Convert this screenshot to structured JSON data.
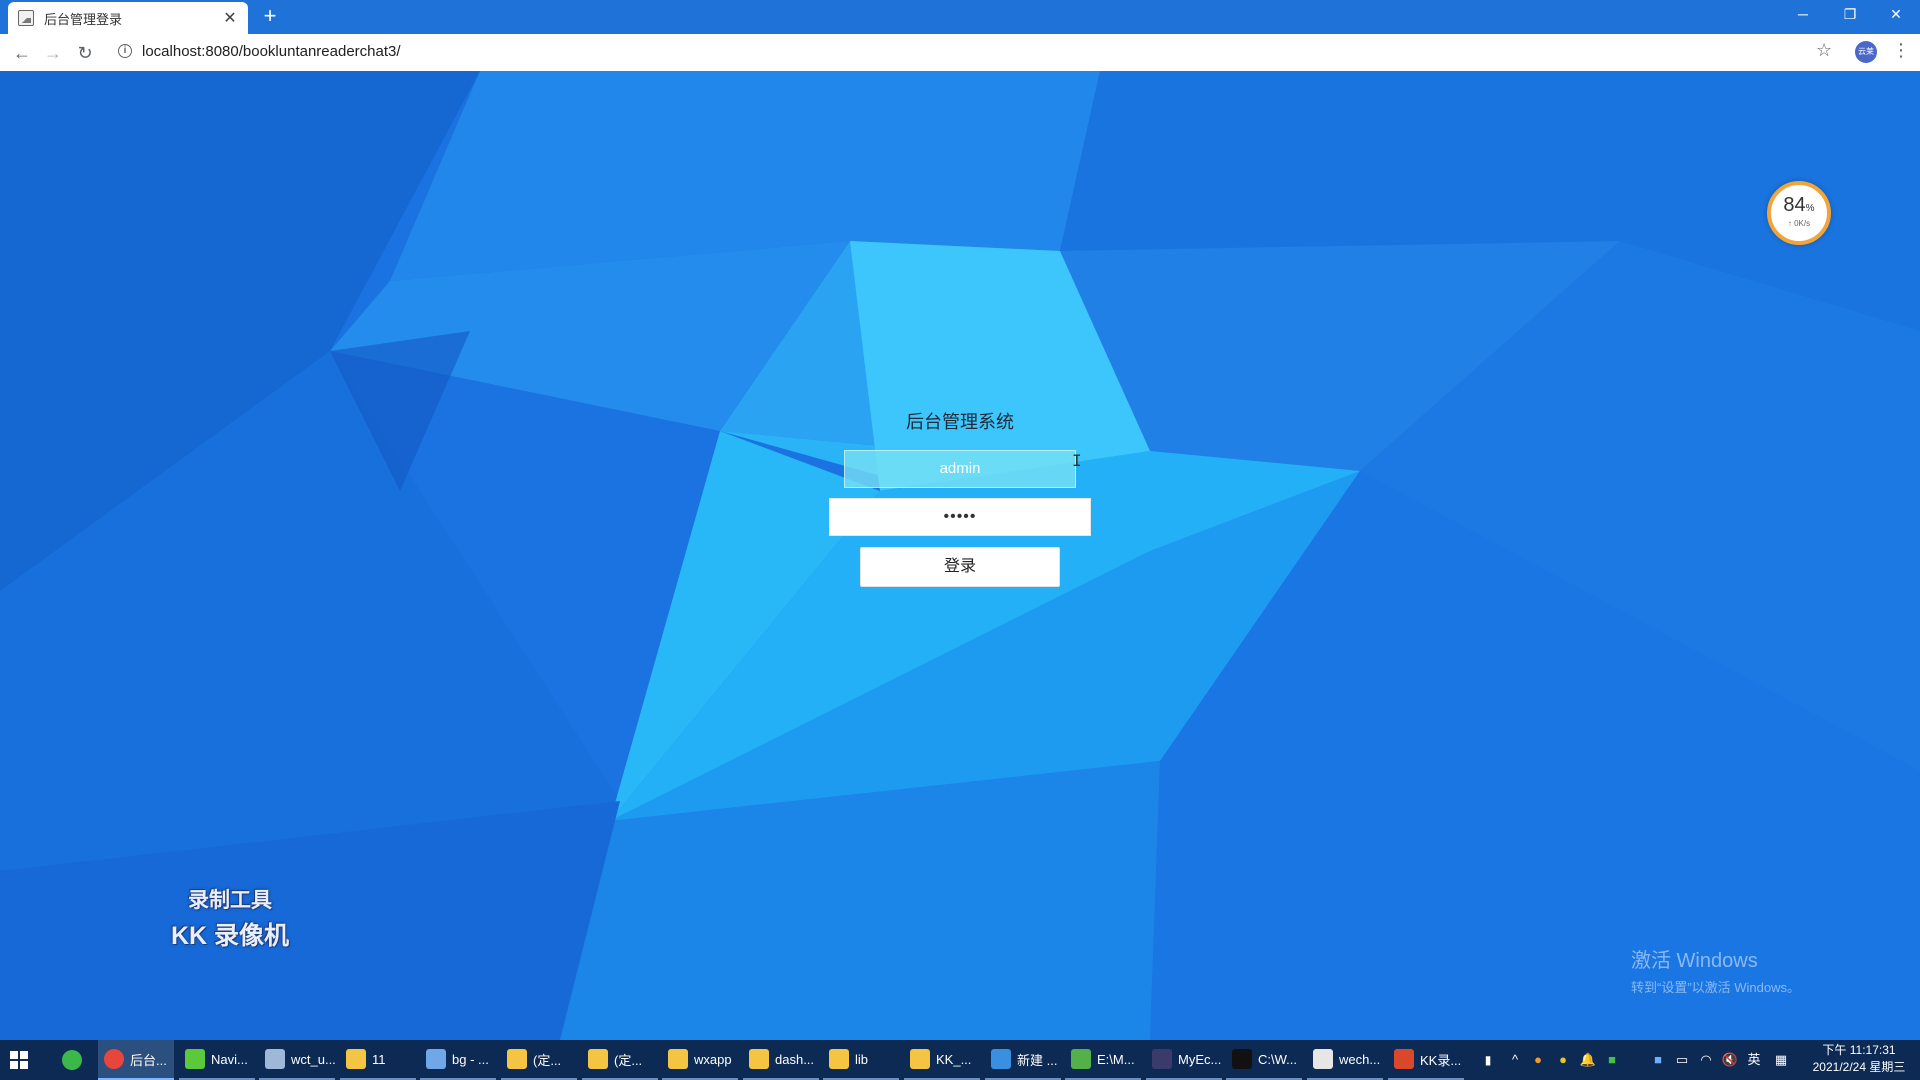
{
  "browser": {
    "tab_title": "后台管理登录",
    "tab_close": "✕",
    "new_tab": "+",
    "url": "localhost:8080/bookluntanreaderchat3/",
    "profile_label": "云莱",
    "window_min": "─",
    "window_restore": "❐",
    "window_close": "✕"
  },
  "login": {
    "title": "后台管理系统",
    "username_value": "admin",
    "password_mask": "•••••",
    "submit_label": "登录"
  },
  "speed_widget": {
    "percent": "84",
    "percent_unit": "%",
    "rate": "↑ 0K/s"
  },
  "watermark": {
    "line1": "录制工具",
    "line2": "KK 录像机"
  },
  "activate_windows": {
    "line1": "激活 Windows",
    "line2": "转到“设置”以激活 Windows。"
  },
  "taskbar": {
    "items": [
      {
        "label": "后台...",
        "icon": "chrome-icon",
        "color": "#e8453c",
        "active": true
      },
      {
        "label": "Navi...",
        "icon": "navicat-icon",
        "color": "#5cc83b",
        "active": false
      },
      {
        "label": "wct_u...",
        "icon": "window-icon",
        "color": "#9fb8d8",
        "active": false
      },
      {
        "label": "11",
        "icon": "folder-icon",
        "color": "#f4c542",
        "active": false
      },
      {
        "label": "bg - ...",
        "icon": "file-icon",
        "color": "#6fa8e8",
        "active": false
      },
      {
        "label": "(定...",
        "icon": "folder-icon",
        "color": "#f4c542",
        "active": false
      },
      {
        "label": "(定...",
        "icon": "folder-icon",
        "color": "#f4c542",
        "active": false
      },
      {
        "label": "wxapp",
        "icon": "folder-icon",
        "color": "#f4c542",
        "active": false
      },
      {
        "label": "dash...",
        "icon": "folder-icon",
        "color": "#f4c542",
        "active": false
      },
      {
        "label": "lib",
        "icon": "folder-icon",
        "color": "#f4c542",
        "active": false
      },
      {
        "label": "KK_...",
        "icon": "folder-icon",
        "color": "#f4c542",
        "active": false
      },
      {
        "label": "新建 ...",
        "icon": "vscode-icon",
        "color": "#3a8fe0",
        "active": false
      },
      {
        "label": "E:\\M...",
        "icon": "notepad-icon",
        "color": "#56b04a",
        "active": false
      },
      {
        "label": "MyEc...",
        "icon": "eclipse-icon",
        "color": "#3b3b6b",
        "active": false
      },
      {
        "label": "C:\\W...",
        "icon": "terminal-icon",
        "color": "#111111",
        "active": false
      },
      {
        "label": "wech...",
        "icon": "wechat-devtools-icon",
        "color": "#e6e6e6",
        "active": false
      },
      {
        "label": "KK录...",
        "icon": "kk-recorder-icon",
        "color": "#d9482b",
        "active": false
      }
    ],
    "ime": "英",
    "time": "下午 11:17:31",
    "date": "2021/2/24 星期三"
  },
  "colors": {
    "page_base": "#1a74e2",
    "taskbar": "#0d2a55",
    "tabbar": "#1f73d8",
    "speed_ring": "#f0a43a"
  }
}
